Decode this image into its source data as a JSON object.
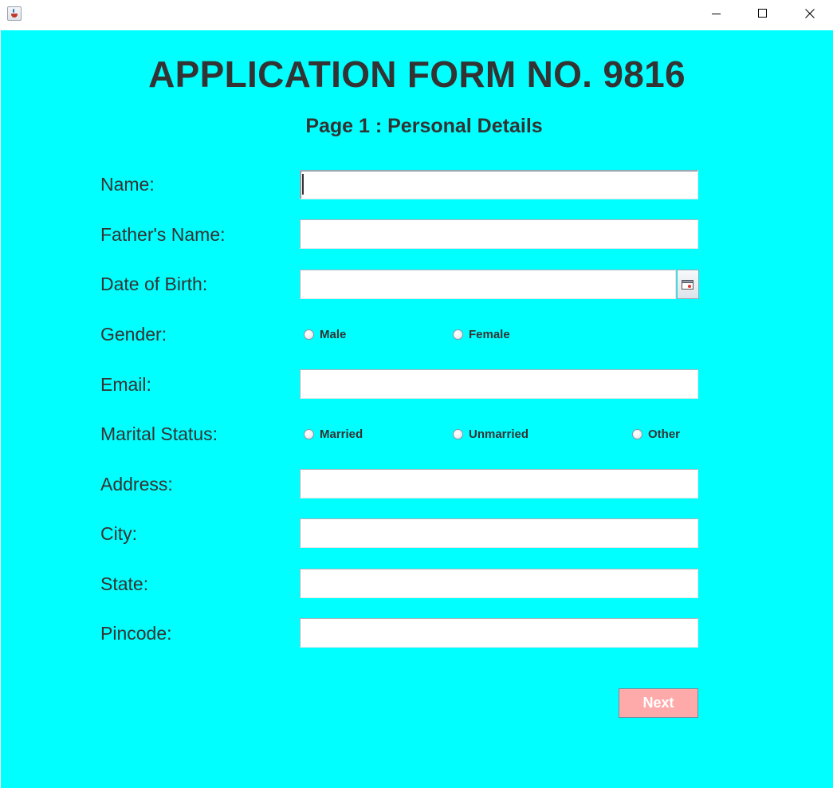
{
  "window": {
    "app_icon": "java-coffee-cup-icon",
    "controls": {
      "minimize_icon": "minimize-icon",
      "maximize_icon": "maximize-icon",
      "close_icon": "close-icon"
    }
  },
  "colors": {
    "background": "#00ffff",
    "text": "#333333",
    "next_button_bg": "#ffaaaa",
    "next_button_text": "#ffffff"
  },
  "form": {
    "title": "APPLICATION FORM NO. 9816",
    "subtitle": "Page 1 : Personal Details",
    "labels": {
      "name": "Name:",
      "father_name": "Father's Name:",
      "dob": "Date of Birth:",
      "gender": "Gender:",
      "email": "Email:",
      "marital_status": "Marital Status:",
      "address": "Address:",
      "city": "City:",
      "state": "State:",
      "pincode": "Pincode:"
    },
    "values": {
      "name": "",
      "father_name": "",
      "dob": "",
      "email": "",
      "address": "",
      "city": "",
      "state": "",
      "pincode": ""
    },
    "gender_options": [
      "Male",
      "Female"
    ],
    "marital_options": [
      "Married",
      "Unmarried",
      "Other"
    ],
    "calendar_icon": "calendar-icon",
    "next_label": "Next"
  }
}
